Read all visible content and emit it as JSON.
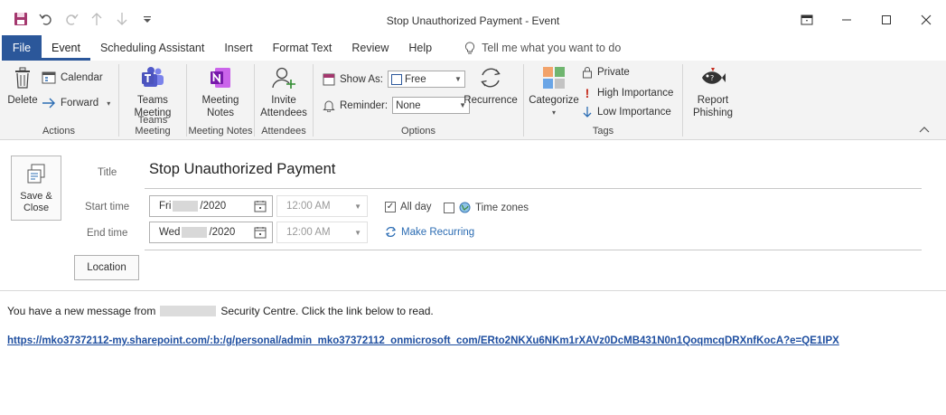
{
  "window": {
    "title": "Stop Unauthorized Payment  -  Event",
    "restore_icon": "ribbon-display-icon",
    "controls": [
      "minimize",
      "maximize",
      "close"
    ]
  },
  "qat": {
    "icons": [
      "save-icon",
      "undo-icon",
      "redo-icon",
      "up-arrow-icon",
      "down-arrow-icon",
      "customize-icon"
    ]
  },
  "tabs": {
    "file": "File",
    "event": "Event",
    "scheduling": "Scheduling Assistant",
    "insert": "Insert",
    "format_text": "Format Text",
    "review": "Review",
    "help": "Help",
    "tell_me": "Tell me what you want to do"
  },
  "ribbon": {
    "actions": {
      "delete": "Delete",
      "calendar": "Calendar",
      "forward": "Forward",
      "label": "Actions"
    },
    "teams": {
      "button": "Teams\nMeeting",
      "label": "Teams Meeting"
    },
    "notes": {
      "button": "Meeting\nNotes",
      "label": "Meeting Notes"
    },
    "attendees": {
      "button": "Invite\nAttendees",
      "label": "Attendees"
    },
    "options": {
      "show_as_label": "Show As:",
      "show_as_value": "Free",
      "reminder_label": "Reminder:",
      "reminder_value": "None",
      "recurrence": "Recurrence",
      "label": "Options"
    },
    "tags": {
      "categorize": "Categorize",
      "private": "Private",
      "high": "High Importance",
      "low": "Low Importance",
      "label": "Tags"
    },
    "phishing": {
      "button": "Report\nPhishing"
    }
  },
  "form": {
    "save_close": "Save &\nClose",
    "title_label": "Title",
    "title_value": "Stop Unauthorized Payment",
    "start_label": "Start time",
    "start_day": "Fri",
    "start_year": "/2020",
    "start_time": "12:00 AM",
    "end_label": "End time",
    "end_day": "Wed",
    "end_year": "/2020",
    "end_time": "12:00 AM",
    "all_day": "All day",
    "all_day_checked": true,
    "time_zones": "Time zones",
    "time_zones_checked": false,
    "make_recurring": "Make Recurring",
    "location": "Location"
  },
  "body": {
    "message_prefix": "You have a new message from",
    "message_suffix": "Security Centre. Click the link below to read.",
    "link": "https://mko37372112-my.sharepoint.com/:b:/g/personal/admin_mko37372112_onmicrosoft_com/ERto2NKXu6NKm1rXAVz0DcMB431N0n1QoqmcqDRXnfKocA?e=QE1IPX"
  },
  "colors": {
    "accent": "#2b579a",
    "ribbon_bg": "#f3f3f3",
    "link": "#1f4fa0"
  }
}
